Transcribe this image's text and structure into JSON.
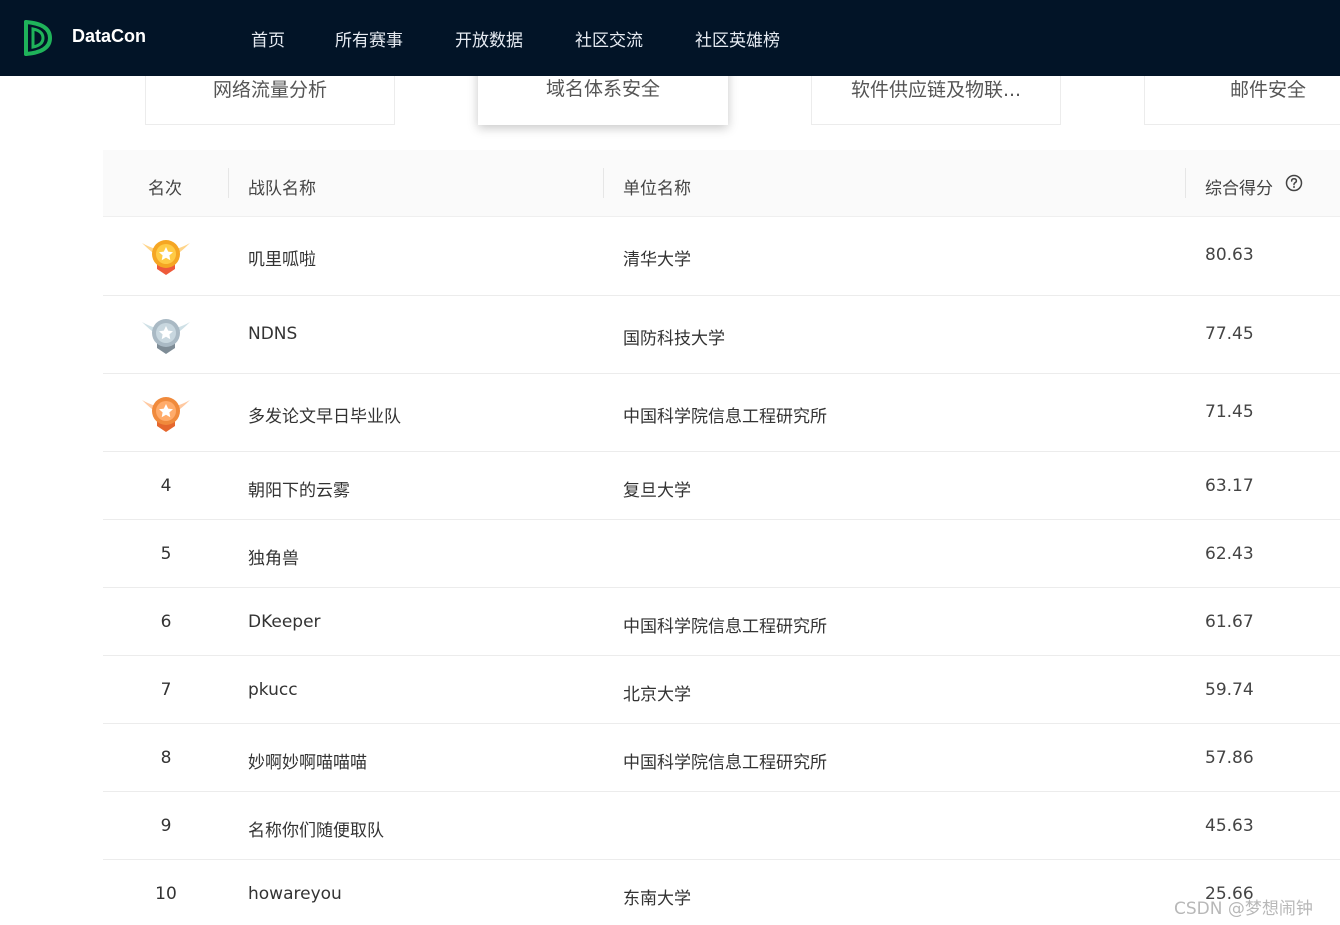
{
  "nav": {
    "brand": "DataCon",
    "items": [
      "首页",
      "所有赛事",
      "开放数据",
      "社区交流",
      "社区英雄榜"
    ]
  },
  "categories": [
    {
      "label": "网络流量分析",
      "active": false
    },
    {
      "label": "域名体系安全",
      "active": true
    },
    {
      "label": "软件供应链及物联...",
      "active": false
    },
    {
      "label": "邮件安全",
      "active": false
    }
  ],
  "table": {
    "headers": {
      "rank": "名次",
      "team": "战队名称",
      "org": "单位名称",
      "score": "综合得分"
    },
    "rows": [
      {
        "rank": "1",
        "medal": "gold",
        "team": "叽里呱啦",
        "org": "清华大学",
        "score": "80.63"
      },
      {
        "rank": "2",
        "medal": "silver",
        "team": "NDNS",
        "org": "国防科技大学",
        "score": "77.45"
      },
      {
        "rank": "3",
        "medal": "bronze",
        "team": "多发论文早日毕业队",
        "org": "中国科学院信息工程研究所",
        "score": "71.45"
      },
      {
        "rank": "4",
        "team": "朝阳下的云雾",
        "org": "复旦大学",
        "score": "63.17"
      },
      {
        "rank": "5",
        "team": "独角兽",
        "org": "",
        "score": "62.43"
      },
      {
        "rank": "6",
        "team": "DKeeper",
        "org": "中国科学院信息工程研究所",
        "score": "61.67"
      },
      {
        "rank": "7",
        "team": "pkucc",
        "org": "北京大学",
        "score": "59.74"
      },
      {
        "rank": "8",
        "team": "妙啊妙啊喵喵喵",
        "org": "中国科学院信息工程研究所",
        "score": "57.86"
      },
      {
        "rank": "9",
        "team": "名称你们随便取队",
        "org": "",
        "score": "45.63"
      },
      {
        "rank": "10",
        "team": "howareyou",
        "org": "东南大学",
        "score": "25.66"
      }
    ]
  },
  "colors": {
    "nav_bg": "#021427",
    "logo_green": "#1fb35a",
    "gold": "#f5a623",
    "silver": "#a9b9c4",
    "bronze": "#f08a3c"
  },
  "watermark": "CSDN @梦想闹钟"
}
